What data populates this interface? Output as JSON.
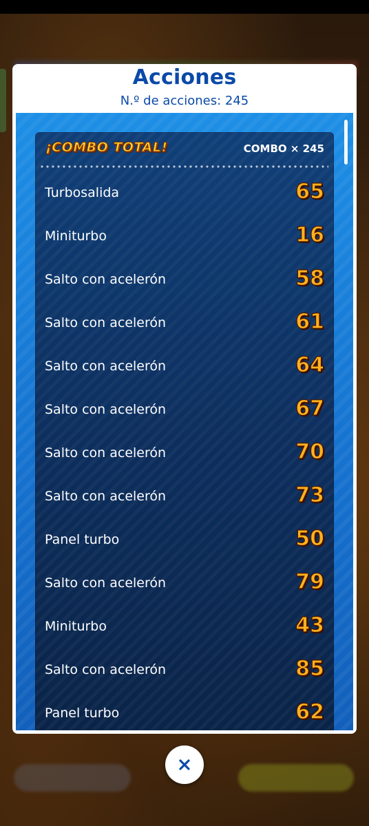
{
  "modal": {
    "title": "Acciones",
    "subtitle": "N.º de acciones: 245"
  },
  "combo": {
    "badge": "¡COMBO TOTAL!",
    "count": "COMBO × 245"
  },
  "actions": [
    {
      "label": "Turbosalida",
      "value": "65"
    },
    {
      "label": "Miniturbo",
      "value": "16"
    },
    {
      "label": "Salto con acelerón",
      "value": "58"
    },
    {
      "label": "Salto con acelerón",
      "value": "61"
    },
    {
      "label": "Salto con acelerón",
      "value": "64"
    },
    {
      "label": "Salto con acelerón",
      "value": "67"
    },
    {
      "label": "Salto con acelerón",
      "value": "70"
    },
    {
      "label": "Salto con acelerón",
      "value": "73"
    },
    {
      "label": "Panel turbo",
      "value": "50"
    },
    {
      "label": "Salto con acelerón",
      "value": "79"
    },
    {
      "label": "Miniturbo",
      "value": "43"
    },
    {
      "label": "Salto con acelerón",
      "value": "85"
    },
    {
      "label": "Panel turbo",
      "value": "62"
    }
  ],
  "icons": {
    "close": "close-icon"
  },
  "colors": {
    "title": "#0b4aa8",
    "panel": "#0d2f5e",
    "value": "#ffb21e",
    "blue_area": "#1673d0"
  }
}
